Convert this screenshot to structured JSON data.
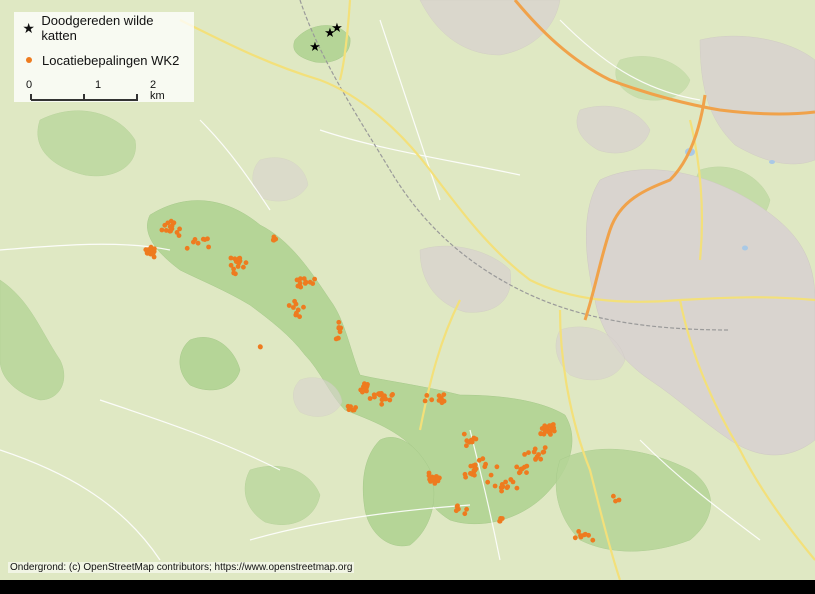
{
  "legend": {
    "star_label": "Doodgereden wilde katten",
    "dot_label": "Locatiebepalingen WK2",
    "star_color": "#000000",
    "dot_color": "#ee7b1f"
  },
  "scalebar": {
    "labels": [
      "0",
      "1",
      "2 km"
    ],
    "values_km": [
      0,
      1,
      2
    ]
  },
  "attribution": "Ondergrond: (c) OpenStreetMap contributors; https://www.openstreetmap.org",
  "map_colors": {
    "land": "#dfe8c3",
    "forest": "#b5d597",
    "urban": "#d9d4cf",
    "motorway": "#f0a24a",
    "primary_road": "#f3e07a"
  }
}
